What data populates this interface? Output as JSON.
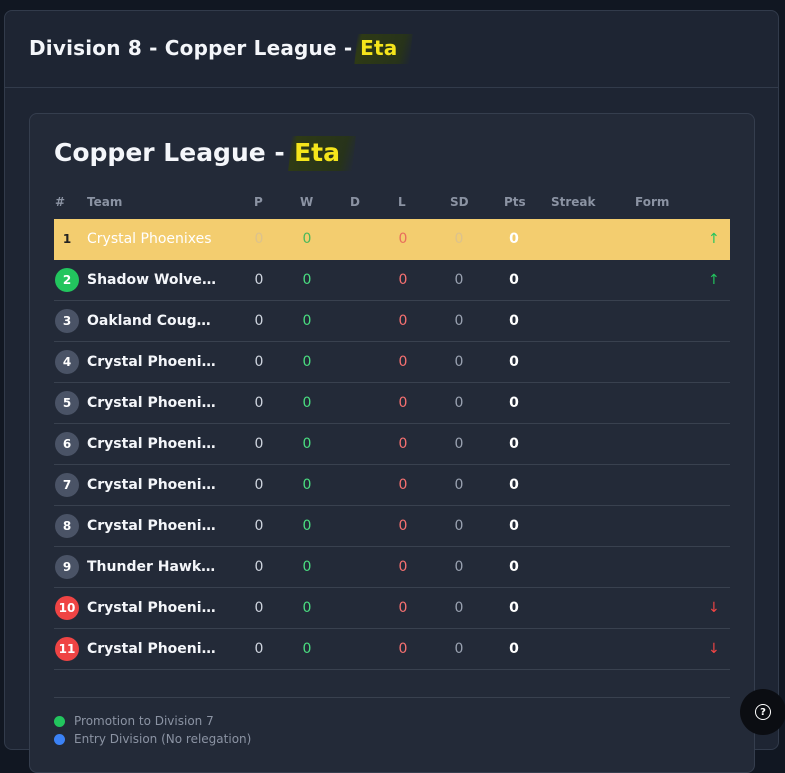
{
  "header": {
    "title_prefix": "Division 8 - Copper League - ",
    "title_highlight": "Eta"
  },
  "standings": {
    "title_prefix": "Copper League - ",
    "title_highlight": "Eta",
    "columns": {
      "rank": "#",
      "team": "Team",
      "p": "P",
      "w": "W",
      "d": "D",
      "l": "L",
      "sd": "SD",
      "pts": "Pts",
      "streak": "Streak",
      "form": "Form"
    },
    "rows": [
      {
        "rank": "1",
        "team": "Crystal Phoenixes",
        "p": "0",
        "w": "0",
        "l": "0",
        "sd": "0",
        "pts": "0",
        "arrow": "↑",
        "status": "first"
      },
      {
        "rank": "2",
        "team": "Shadow Wolves Elite",
        "p": "0",
        "w": "0",
        "l": "0",
        "sd": "0",
        "pts": "0",
        "arrow": "↑",
        "status": "promo"
      },
      {
        "rank": "3",
        "team": "Oakland Cougars",
        "p": "0",
        "w": "0",
        "l": "0",
        "sd": "0",
        "pts": "0",
        "arrow": "",
        "status": "none"
      },
      {
        "rank": "4",
        "team": "Crystal Phoenixes",
        "p": "0",
        "w": "0",
        "l": "0",
        "sd": "0",
        "pts": "0",
        "arrow": "",
        "status": "none"
      },
      {
        "rank": "5",
        "team": "Crystal Phoenixes",
        "p": "0",
        "w": "0",
        "l": "0",
        "sd": "0",
        "pts": "0",
        "arrow": "",
        "status": "none"
      },
      {
        "rank": "6",
        "team": "Crystal Phoenixes",
        "p": "0",
        "w": "0",
        "l": "0",
        "sd": "0",
        "pts": "0",
        "arrow": "",
        "status": "none"
      },
      {
        "rank": "7",
        "team": "Crystal Phoenixes",
        "p": "0",
        "w": "0",
        "l": "0",
        "sd": "0",
        "pts": "0",
        "arrow": "",
        "status": "none"
      },
      {
        "rank": "8",
        "team": "Crystal Phoenixes",
        "p": "0",
        "w": "0",
        "l": "0",
        "sd": "0",
        "pts": "0",
        "arrow": "",
        "status": "none"
      },
      {
        "rank": "9",
        "team": "Thunder Hawks Elite",
        "p": "0",
        "w": "0",
        "l": "0",
        "sd": "0",
        "pts": "0",
        "arrow": "",
        "status": "none"
      },
      {
        "rank": "10",
        "team": "Crystal Phoenixes",
        "p": "0",
        "w": "0",
        "l": "0",
        "sd": "0",
        "pts": "0",
        "arrow": "↓",
        "status": "releg"
      },
      {
        "rank": "11",
        "team": "Crystal Phoenixes",
        "p": "0",
        "w": "0",
        "l": "0",
        "sd": "0",
        "pts": "0",
        "arrow": "↓",
        "status": "releg"
      }
    ]
  },
  "legend": [
    {
      "label": "Promotion to Division 7",
      "color": "#22c55e"
    },
    {
      "label": "Entry Division (No relegation)",
      "color": "#3b82f6"
    }
  ],
  "help": {
    "icon": "question-circle-icon",
    "glyph": "?"
  }
}
